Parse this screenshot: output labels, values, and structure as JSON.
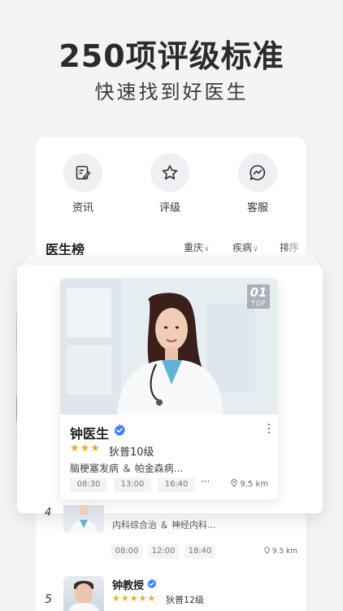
{
  "hero": {
    "headline": "250项评级标准",
    "subline": "快速找到好医生"
  },
  "shortcuts": [
    {
      "label": "资讯",
      "icon": "news-edit-icon"
    },
    {
      "label": "评级",
      "icon": "star-outline-icon"
    },
    {
      "label": "客服",
      "icon": "chat-bubble-icon"
    }
  ],
  "ranking": {
    "title": "医生榜",
    "filters": [
      {
        "label": "重庆",
        "icon": "chevron-down-icon"
      },
      {
        "label": "疾病",
        "icon": "chevron-down-icon"
      },
      {
        "label": "排序"
      }
    ]
  },
  "featured_doctor": {
    "rank_number": "01",
    "rank_tag": "TOP",
    "name": "钟医生",
    "stars": "★★★",
    "level": "狄普10级",
    "diseases": "脑梗塞发病 ＆ 帕金森病...",
    "time_slots": [
      "08:30",
      "13:00",
      "16:40"
    ],
    "more_slots": "···",
    "distance": "9.5 km"
  },
  "doctor_4": {
    "rank": "4",
    "tags": "内科综合治 ＆ 神经内科...",
    "time_slots": [
      "08:00",
      "12:00",
      "18:40"
    ],
    "distance": "9.5 km"
  },
  "doctor_5": {
    "rank": "5",
    "name": "钟教授",
    "stars": "★★★★★",
    "level": "狄普12级"
  },
  "colors": {
    "star": "#f5a623",
    "verified": "#3b7ff2",
    "background": "#f3f4f6"
  }
}
